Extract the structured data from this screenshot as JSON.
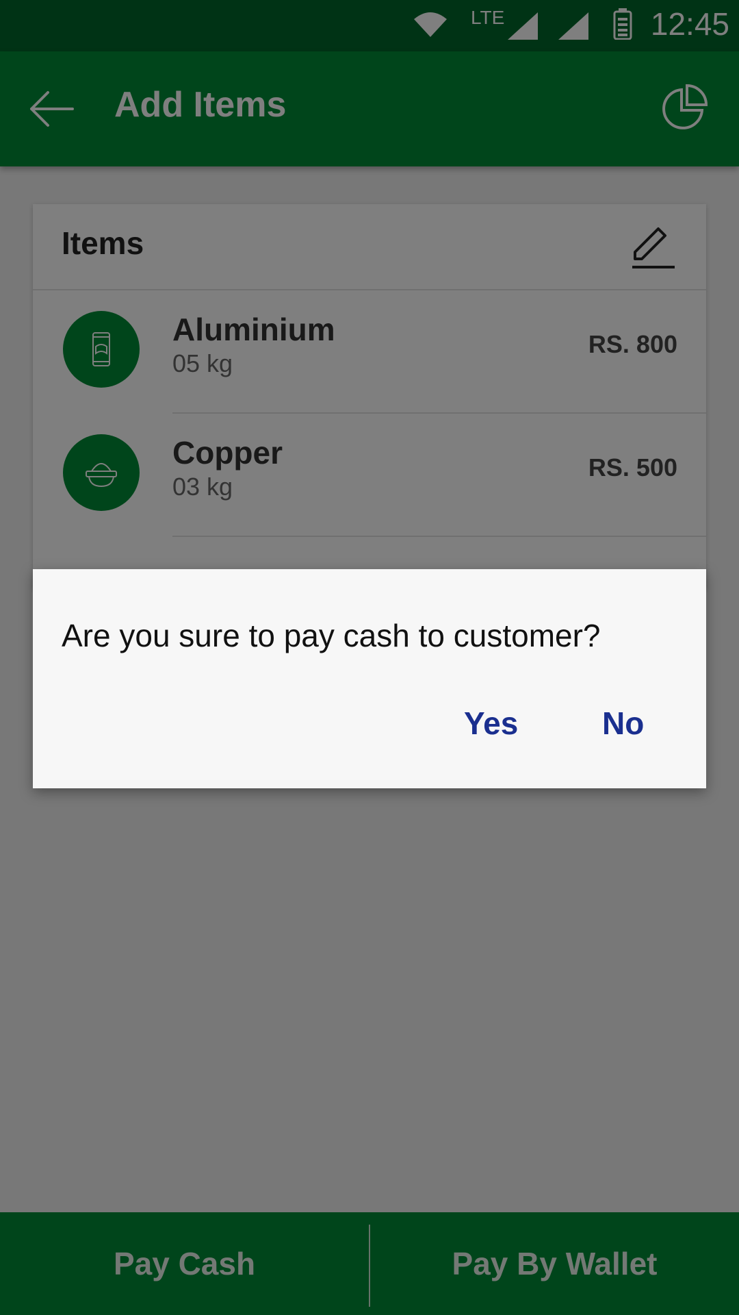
{
  "status_bar": {
    "network": "LTE",
    "time": "12:45"
  },
  "app_bar": {
    "title": "Add Items",
    "back_icon": "arrow-left-icon",
    "action_icon": "pie-chart-icon"
  },
  "items_card": {
    "title": "Items",
    "edit_icon": "pencil-icon",
    "items": [
      {
        "name": "Aluminium",
        "qty": "05 kg",
        "price": "RS. 800",
        "icon": "can-icon"
      },
      {
        "name": "Copper",
        "qty": "03 kg",
        "price": "RS. 500",
        "icon": "pot-icon"
      }
    ]
  },
  "dialog": {
    "message": "Are you sure to pay cash to customer?",
    "yes_label": "Yes",
    "no_label": "No"
  },
  "bottom_bar": {
    "pay_cash_label": "Pay Cash",
    "pay_wallet_label": "Pay By Wallet"
  },
  "colors": {
    "primary": "#008a36",
    "primary_dark": "#00662a",
    "dialog_button": "#1a2f8f"
  }
}
